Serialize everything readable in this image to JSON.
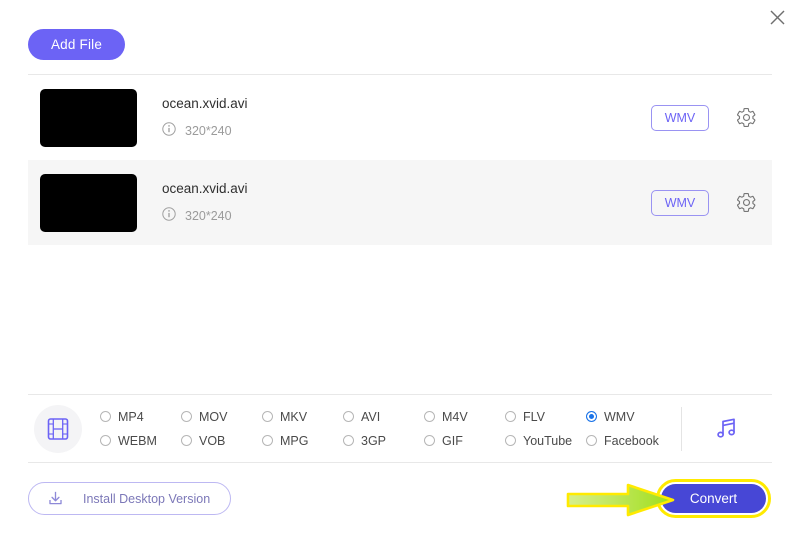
{
  "window": {
    "close_icon": "close-icon"
  },
  "toolbar": {
    "add_file_label": "Add File"
  },
  "files": [
    {
      "thumbnail": "video-thumbnail",
      "name": "ocean.xvid.avi",
      "info_icon": "info-icon",
      "dimensions": "320*240",
      "format_badge": "WMV",
      "settings_icon": "gear-icon",
      "highlighted": false
    },
    {
      "thumbnail": "video-thumbnail",
      "name": "ocean.xvid.avi",
      "info_icon": "info-icon",
      "dimensions": "320*240",
      "format_badge": "WMV",
      "settings_icon": "gear-icon",
      "highlighted": true
    }
  ],
  "format_bar": {
    "video_icon": "film-strip-icon",
    "audio_icon": "music-note-icon",
    "selected_format": "WMV",
    "options": [
      {
        "label": "MP4",
        "selected": false
      },
      {
        "label": "MOV",
        "selected": false
      },
      {
        "label": "MKV",
        "selected": false
      },
      {
        "label": "AVI",
        "selected": false
      },
      {
        "label": "M4V",
        "selected": false
      },
      {
        "label": "FLV",
        "selected": false
      },
      {
        "label": "WMV",
        "selected": true
      },
      {
        "label": "WEBM",
        "selected": false
      },
      {
        "label": "VOB",
        "selected": false
      },
      {
        "label": "MPG",
        "selected": false
      },
      {
        "label": "3GP",
        "selected": false
      },
      {
        "label": "GIF",
        "selected": false
      },
      {
        "label": "YouTube",
        "selected": false
      },
      {
        "label": "Facebook",
        "selected": false
      }
    ]
  },
  "footer": {
    "install_label": "Install Desktop Version",
    "install_icon": "download-icon",
    "convert_label": "Convert"
  },
  "annotation": {
    "arrow": "green-arrow-pointer",
    "highlight_color": "#ffea00",
    "arrow_color": "#a8e020"
  },
  "colors": {
    "accent_purple": "#6c63f5",
    "convert_blue": "#4747d6",
    "radio_selected": "#1a73e8",
    "row_highlight": "#f6f6f6"
  }
}
